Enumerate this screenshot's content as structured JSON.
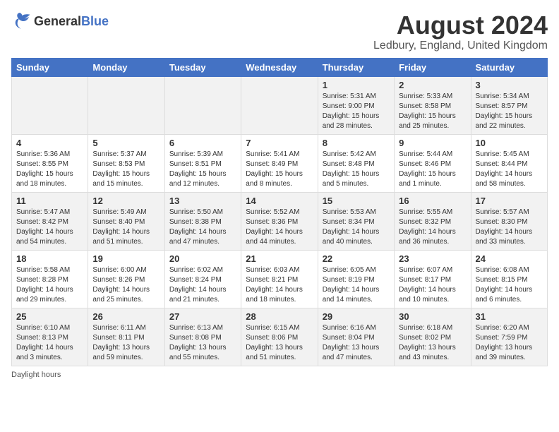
{
  "header": {
    "logo_general": "General",
    "logo_blue": "Blue",
    "title": "August 2024",
    "subtitle": "Ledbury, England, United Kingdom"
  },
  "days_of_week": [
    "Sunday",
    "Monday",
    "Tuesday",
    "Wednesday",
    "Thursday",
    "Friday",
    "Saturday"
  ],
  "footer": {
    "note": "Daylight hours"
  },
  "weeks": [
    [
      {
        "day": "",
        "sunrise": "",
        "sunset": "",
        "daylight": ""
      },
      {
        "day": "",
        "sunrise": "",
        "sunset": "",
        "daylight": ""
      },
      {
        "day": "",
        "sunrise": "",
        "sunset": "",
        "daylight": ""
      },
      {
        "day": "",
        "sunrise": "",
        "sunset": "",
        "daylight": ""
      },
      {
        "day": "1",
        "sunrise": "Sunrise: 5:31 AM",
        "sunset": "Sunset: 9:00 PM",
        "daylight": "Daylight: 15 hours and 28 minutes."
      },
      {
        "day": "2",
        "sunrise": "Sunrise: 5:33 AM",
        "sunset": "Sunset: 8:58 PM",
        "daylight": "Daylight: 15 hours and 25 minutes."
      },
      {
        "day": "3",
        "sunrise": "Sunrise: 5:34 AM",
        "sunset": "Sunset: 8:57 PM",
        "daylight": "Daylight: 15 hours and 22 minutes."
      }
    ],
    [
      {
        "day": "4",
        "sunrise": "Sunrise: 5:36 AM",
        "sunset": "Sunset: 8:55 PM",
        "daylight": "Daylight: 15 hours and 18 minutes."
      },
      {
        "day": "5",
        "sunrise": "Sunrise: 5:37 AM",
        "sunset": "Sunset: 8:53 PM",
        "daylight": "Daylight: 15 hours and 15 minutes."
      },
      {
        "day": "6",
        "sunrise": "Sunrise: 5:39 AM",
        "sunset": "Sunset: 8:51 PM",
        "daylight": "Daylight: 15 hours and 12 minutes."
      },
      {
        "day": "7",
        "sunrise": "Sunrise: 5:41 AM",
        "sunset": "Sunset: 8:49 PM",
        "daylight": "Daylight: 15 hours and 8 minutes."
      },
      {
        "day": "8",
        "sunrise": "Sunrise: 5:42 AM",
        "sunset": "Sunset: 8:48 PM",
        "daylight": "Daylight: 15 hours and 5 minutes."
      },
      {
        "day": "9",
        "sunrise": "Sunrise: 5:44 AM",
        "sunset": "Sunset: 8:46 PM",
        "daylight": "Daylight: 15 hours and 1 minute."
      },
      {
        "day": "10",
        "sunrise": "Sunrise: 5:45 AM",
        "sunset": "Sunset: 8:44 PM",
        "daylight": "Daylight: 14 hours and 58 minutes."
      }
    ],
    [
      {
        "day": "11",
        "sunrise": "Sunrise: 5:47 AM",
        "sunset": "Sunset: 8:42 PM",
        "daylight": "Daylight: 14 hours and 54 minutes."
      },
      {
        "day": "12",
        "sunrise": "Sunrise: 5:49 AM",
        "sunset": "Sunset: 8:40 PM",
        "daylight": "Daylight: 14 hours and 51 minutes."
      },
      {
        "day": "13",
        "sunrise": "Sunrise: 5:50 AM",
        "sunset": "Sunset: 8:38 PM",
        "daylight": "Daylight: 14 hours and 47 minutes."
      },
      {
        "day": "14",
        "sunrise": "Sunrise: 5:52 AM",
        "sunset": "Sunset: 8:36 PM",
        "daylight": "Daylight: 14 hours and 44 minutes."
      },
      {
        "day": "15",
        "sunrise": "Sunrise: 5:53 AM",
        "sunset": "Sunset: 8:34 PM",
        "daylight": "Daylight: 14 hours and 40 minutes."
      },
      {
        "day": "16",
        "sunrise": "Sunrise: 5:55 AM",
        "sunset": "Sunset: 8:32 PM",
        "daylight": "Daylight: 14 hours and 36 minutes."
      },
      {
        "day": "17",
        "sunrise": "Sunrise: 5:57 AM",
        "sunset": "Sunset: 8:30 PM",
        "daylight": "Daylight: 14 hours and 33 minutes."
      }
    ],
    [
      {
        "day": "18",
        "sunrise": "Sunrise: 5:58 AM",
        "sunset": "Sunset: 8:28 PM",
        "daylight": "Daylight: 14 hours and 29 minutes."
      },
      {
        "day": "19",
        "sunrise": "Sunrise: 6:00 AM",
        "sunset": "Sunset: 8:26 PM",
        "daylight": "Daylight: 14 hours and 25 minutes."
      },
      {
        "day": "20",
        "sunrise": "Sunrise: 6:02 AM",
        "sunset": "Sunset: 8:24 PM",
        "daylight": "Daylight: 14 hours and 21 minutes."
      },
      {
        "day": "21",
        "sunrise": "Sunrise: 6:03 AM",
        "sunset": "Sunset: 8:21 PM",
        "daylight": "Daylight: 14 hours and 18 minutes."
      },
      {
        "day": "22",
        "sunrise": "Sunrise: 6:05 AM",
        "sunset": "Sunset: 8:19 PM",
        "daylight": "Daylight: 14 hours and 14 minutes."
      },
      {
        "day": "23",
        "sunrise": "Sunrise: 6:07 AM",
        "sunset": "Sunset: 8:17 PM",
        "daylight": "Daylight: 14 hours and 10 minutes."
      },
      {
        "day": "24",
        "sunrise": "Sunrise: 6:08 AM",
        "sunset": "Sunset: 8:15 PM",
        "daylight": "Daylight: 14 hours and 6 minutes."
      }
    ],
    [
      {
        "day": "25",
        "sunrise": "Sunrise: 6:10 AM",
        "sunset": "Sunset: 8:13 PM",
        "daylight": "Daylight: 14 hours and 3 minutes."
      },
      {
        "day": "26",
        "sunrise": "Sunrise: 6:11 AM",
        "sunset": "Sunset: 8:11 PM",
        "daylight": "Daylight: 13 hours and 59 minutes."
      },
      {
        "day": "27",
        "sunrise": "Sunrise: 6:13 AM",
        "sunset": "Sunset: 8:08 PM",
        "daylight": "Daylight: 13 hours and 55 minutes."
      },
      {
        "day": "28",
        "sunrise": "Sunrise: 6:15 AM",
        "sunset": "Sunset: 8:06 PM",
        "daylight": "Daylight: 13 hours and 51 minutes."
      },
      {
        "day": "29",
        "sunrise": "Sunrise: 6:16 AM",
        "sunset": "Sunset: 8:04 PM",
        "daylight": "Daylight: 13 hours and 47 minutes."
      },
      {
        "day": "30",
        "sunrise": "Sunrise: 6:18 AM",
        "sunset": "Sunset: 8:02 PM",
        "daylight": "Daylight: 13 hours and 43 minutes."
      },
      {
        "day": "31",
        "sunrise": "Sunrise: 6:20 AM",
        "sunset": "Sunset: 7:59 PM",
        "daylight": "Daylight: 13 hours and 39 minutes."
      }
    ]
  ]
}
